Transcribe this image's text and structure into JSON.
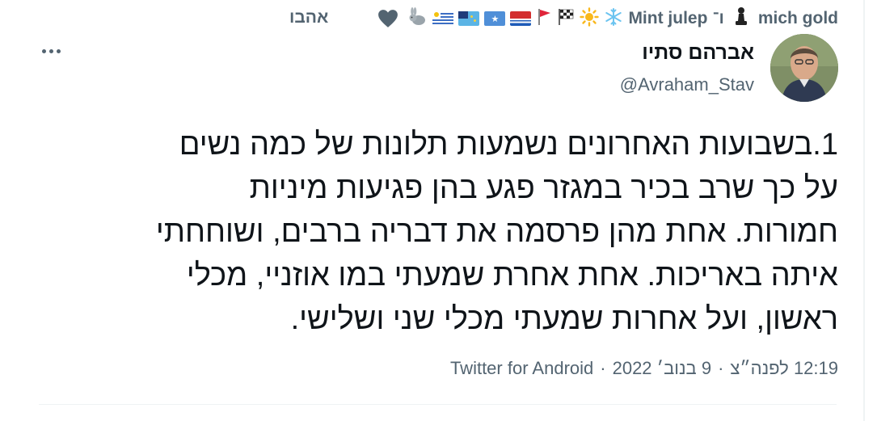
{
  "social_context": {
    "text_main": "mich gold",
    "text_mint": "Mint julep",
    "text_suffix": "ו־",
    "text_end": "אהבו",
    "icons": [
      "heart-icon",
      "chess-pawn-icon",
      "snowflake-icon",
      "sun-icon",
      "checkered-flag-icon",
      "red-flag-icon"
    ]
  },
  "tweet": {
    "display_name": "אברהם סתיו",
    "handle": "@Avraham_Stav",
    "lines": [
      "1.בשבועות האחרונים נשמעות תלונות של כמה נשים",
      "על כך שרב בכיר במגזר פגע בהן פגיעות מיניות",
      "חמורות. אחת מהן פרסמה את דבריה ברבים, ושוחחתי",
      "איתה באריכות. אחת אחרת שמעתי במו אוזניי, מכלי",
      "ראשון, ועל אחרות שמעתי מכלי שני ושלישי."
    ],
    "time": "12:19 לפנה״צ",
    "date": "9 בנוב׳ 2022",
    "source": "Twitter for Android",
    "separator": "·"
  }
}
